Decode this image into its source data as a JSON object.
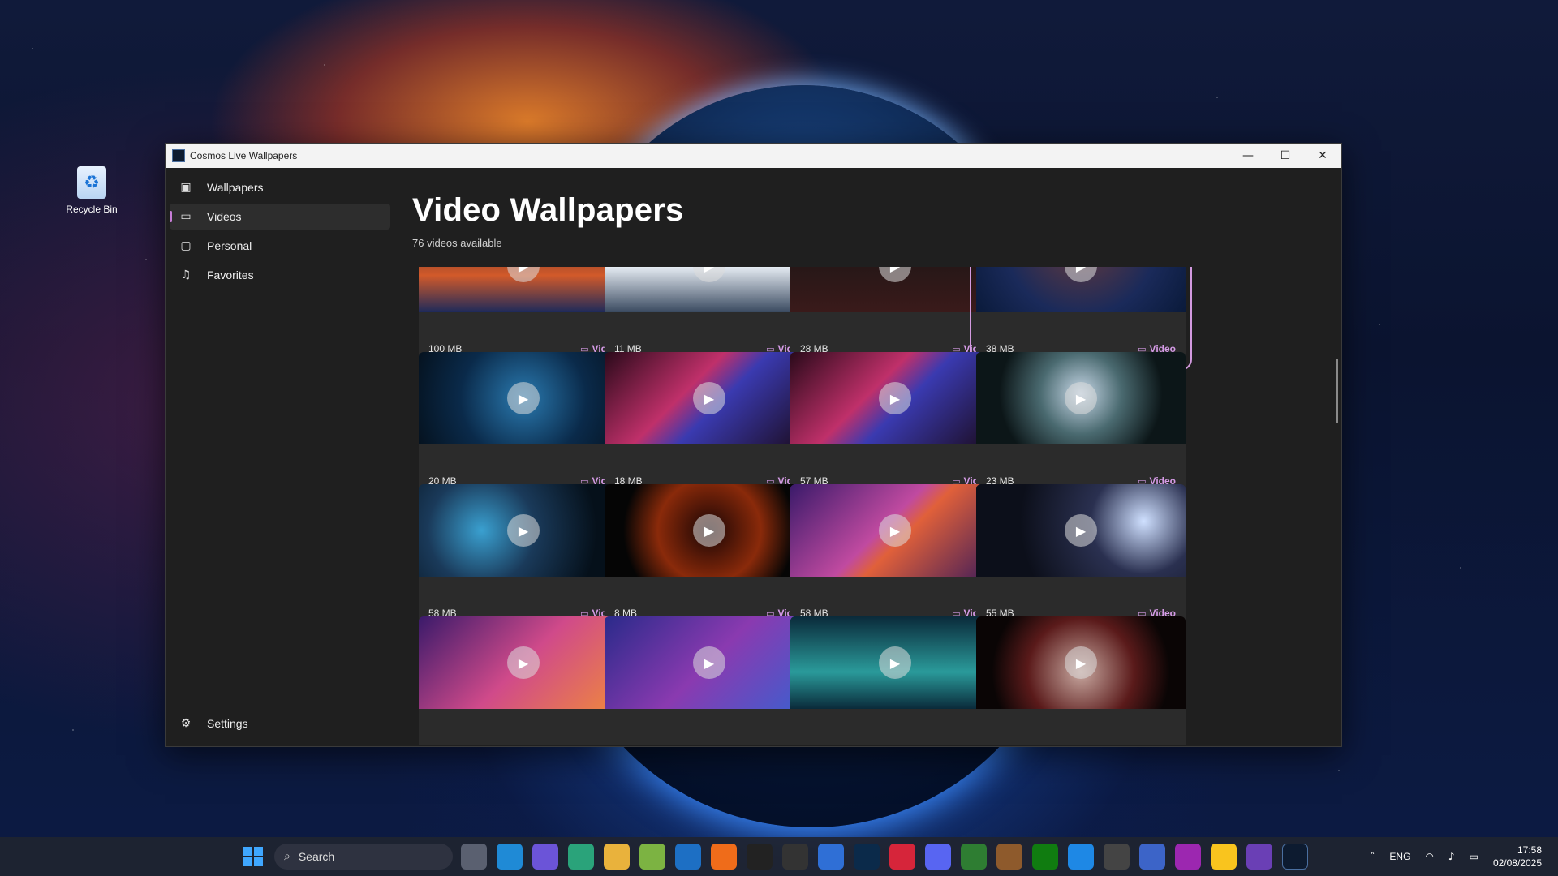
{
  "desktop": {
    "recycle_bin_label": "Recycle Bin"
  },
  "window": {
    "title": "Cosmos Live Wallpapers",
    "minimize": "—",
    "maximize": "☐",
    "close": "✕"
  },
  "sidebar": {
    "items": [
      {
        "label": "Wallpapers",
        "icon": "image-icon",
        "active": false
      },
      {
        "label": "Videos",
        "icon": "video-icon",
        "active": true
      },
      {
        "label": "Personal",
        "icon": "folder-icon",
        "active": false
      },
      {
        "label": "Favorites",
        "icon": "music-icon",
        "active": false
      }
    ],
    "settings_label": "Settings"
  },
  "main": {
    "title": "Video Wallpapers",
    "subtitle": "76 videos available",
    "badge_label": "Video",
    "cards": [
      {
        "size": "100 MB"
      },
      {
        "size": "11 MB"
      },
      {
        "size": "28 MB"
      },
      {
        "size": "38 MB",
        "selected": true
      },
      {
        "size": "20 MB"
      },
      {
        "size": "18 MB"
      },
      {
        "size": "57 MB"
      },
      {
        "size": "23 MB"
      },
      {
        "size": "58 MB"
      },
      {
        "size": "8 MB"
      },
      {
        "size": "58 MB"
      },
      {
        "size": "55 MB"
      },
      {
        "size": ""
      },
      {
        "size": ""
      },
      {
        "size": ""
      },
      {
        "size": ""
      }
    ]
  },
  "taskbar": {
    "search_placeholder": "Search",
    "tray_language": "ENG",
    "time": "17:58",
    "date": "02/08/2025"
  }
}
